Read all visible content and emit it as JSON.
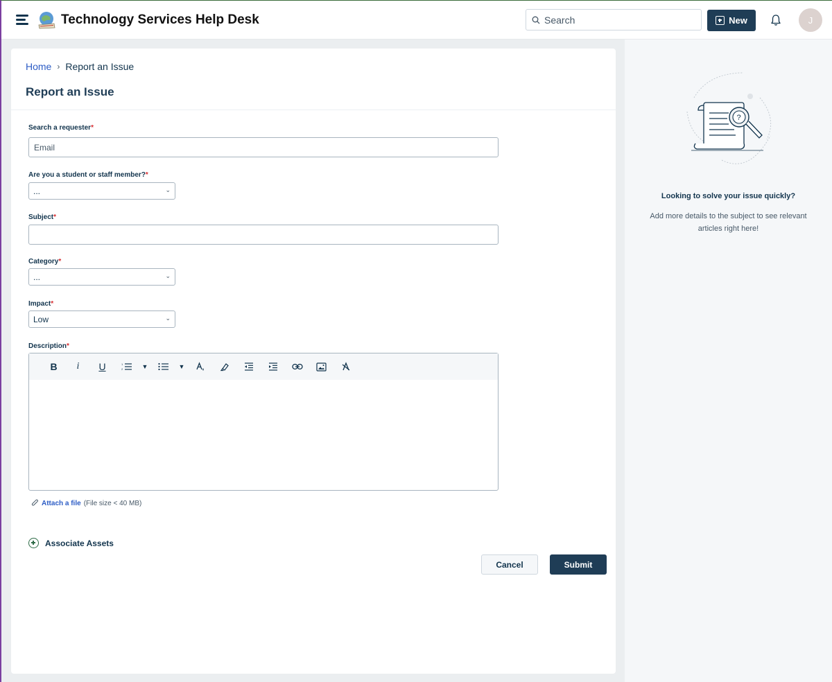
{
  "header": {
    "app_title": "Technology Services Help Desk",
    "search_placeholder": "Search",
    "new_label": "New",
    "avatar_initial": "J"
  },
  "breadcrumb": {
    "home": "Home",
    "separator": "›",
    "current": "Report an Issue"
  },
  "page_title": "Report an Issue",
  "form": {
    "requester": {
      "label": "Search a requester",
      "required": "*",
      "placeholder": "Email"
    },
    "role": {
      "label": "Are you a student or staff member?",
      "required": "*",
      "value": "..."
    },
    "subject": {
      "label": "Subject",
      "required": "*",
      "value": ""
    },
    "category": {
      "label": "Category",
      "required": "*",
      "value": "..."
    },
    "impact": {
      "label": "Impact",
      "required": "*",
      "value": "Low"
    },
    "description": {
      "label": "Description",
      "required": "*",
      "toolbar": [
        "bold-icon",
        "italic-icon",
        "underline-icon",
        "ordered-list-icon",
        "dropdown-caret-icon",
        "unordered-list-icon",
        "dropdown-caret-icon",
        "text-color-icon",
        "highlight-icon",
        "outdent-icon",
        "indent-icon",
        "link-icon",
        "image-icon",
        "clear-format-icon"
      ]
    },
    "attach": {
      "link": "Attach a file",
      "note": "(File size < 40 MB)"
    },
    "associate_assets": "Associate Assets",
    "cancel_label": "Cancel",
    "submit_label": "Submit"
  },
  "side_panel": {
    "title": "Looking to solve your issue quickly?",
    "text": "Add more details to the subject to see relevant articles right here!"
  },
  "colors": {
    "primary": "#1f3d56",
    "link": "#2c5cc5",
    "required": "#d72d30",
    "assets_icon": "#2e6b47"
  }
}
